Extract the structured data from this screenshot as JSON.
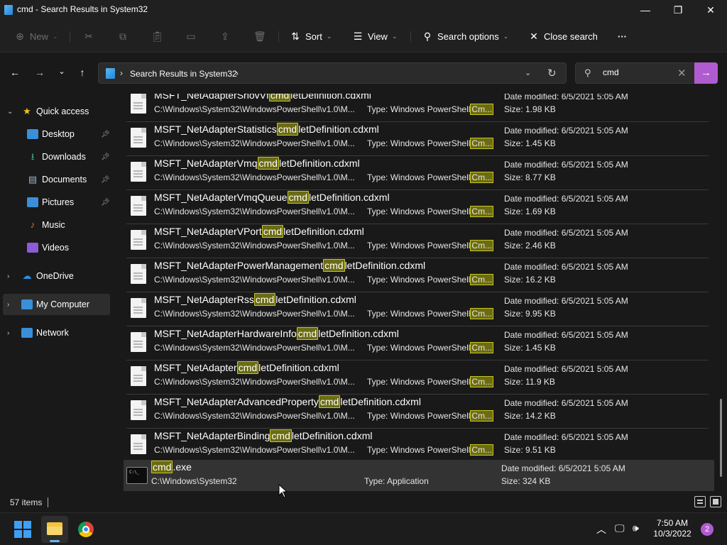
{
  "window": {
    "title": "cmd - Search Results in System32",
    "minimize_icon": "—",
    "maximize_icon": "❐",
    "close_icon": "✕"
  },
  "toolbar": {
    "new_label": "New",
    "sort_label": "Sort",
    "view_label": "View",
    "search_options_label": "Search options",
    "close_search_label": "Close search",
    "more_label": "···"
  },
  "address": {
    "crumb": "Search Results in System32"
  },
  "search": {
    "value": "cmd"
  },
  "sidebar": {
    "items": [
      {
        "label": "Quick access"
      },
      {
        "label": "Desktop"
      },
      {
        "label": "Downloads"
      },
      {
        "label": "Documents"
      },
      {
        "label": "Pictures"
      },
      {
        "label": "Music"
      },
      {
        "label": "Videos"
      },
      {
        "label": "OneDrive"
      },
      {
        "label": "My Computer"
      },
      {
        "label": "Network"
      }
    ]
  },
  "files": [
    {
      "pre": "MSFT_NetAdapterSriovVf",
      "hl": "cmd",
      "post": "letDefinition.cdxml",
      "path": "C:\\Windows\\System32\\WindowsPowerShell\\v1.0\\M...",
      "type_label": "Type:",
      "type": "Windows PowerShell",
      "type_hl": "Cm...",
      "date_label": "Date modified:",
      "date": "6/5/2021 5:05 AM",
      "size_label": "Size:",
      "size": "1.98 KB"
    },
    {
      "pre": "MSFT_NetAdapterStatistics",
      "hl": "cmd",
      "post": "letDefinition.cdxml",
      "path": "C:\\Windows\\System32\\WindowsPowerShell\\v1.0\\M...",
      "type_label": "Type:",
      "type": "Windows PowerShell",
      "type_hl": "Cm...",
      "date_label": "Date modified:",
      "date": "6/5/2021 5:05 AM",
      "size_label": "Size:",
      "size": "1.45 KB"
    },
    {
      "pre": "MSFT_NetAdapterVmq",
      "hl": "cmd",
      "post": "letDefinition.cdxml",
      "path": "C:\\Windows\\System32\\WindowsPowerShell\\v1.0\\M...",
      "type_label": "Type:",
      "type": "Windows PowerShell",
      "type_hl": "Cm...",
      "date_label": "Date modified:",
      "date": "6/5/2021 5:05 AM",
      "size_label": "Size:",
      "size": "8.77 KB"
    },
    {
      "pre": "MSFT_NetAdapterVmqQueue",
      "hl": "cmd",
      "post": "letDefinition.cdxml",
      "path": "C:\\Windows\\System32\\WindowsPowerShell\\v1.0\\M...",
      "type_label": "Type:",
      "type": "Windows PowerShell",
      "type_hl": "Cm...",
      "date_label": "Date modified:",
      "date": "6/5/2021 5:05 AM",
      "size_label": "Size:",
      "size": "1.69 KB"
    },
    {
      "pre": "MSFT_NetAdapterVPort",
      "hl": "cmd",
      "post": "letDefinition.cdxml",
      "path": "C:\\Windows\\System32\\WindowsPowerShell\\v1.0\\M...",
      "type_label": "Type:",
      "type": "Windows PowerShell",
      "type_hl": "Cm...",
      "date_label": "Date modified:",
      "date": "6/5/2021 5:05 AM",
      "size_label": "Size:",
      "size": "2.46 KB"
    },
    {
      "pre": "MSFT_NetAdapterPowerManagement",
      "hl": "cmd",
      "post": "letDefinition.cdxml",
      "path": "C:\\Windows\\System32\\WindowsPowerShell\\v1.0\\M...",
      "type_label": "Type:",
      "type": "Windows PowerShell",
      "type_hl": "Cm...",
      "date_label": "Date modified:",
      "date": "6/5/2021 5:05 AM",
      "size_label": "Size:",
      "size": "16.2 KB"
    },
    {
      "pre": "MSFT_NetAdapterRss",
      "hl": "cmd",
      "post": "letDefinition.cdxml",
      "path": "C:\\Windows\\System32\\WindowsPowerShell\\v1.0\\M...",
      "type_label": "Type:",
      "type": "Windows PowerShell",
      "type_hl": "Cm...",
      "date_label": "Date modified:",
      "date": "6/5/2021 5:05 AM",
      "size_label": "Size:",
      "size": "9.95 KB"
    },
    {
      "pre": "MSFT_NetAdapterHardwareInfo",
      "hl": "cmd",
      "post": "letDefinition.cdxml",
      "path": "C:\\Windows\\System32\\WindowsPowerShell\\v1.0\\M...",
      "type_label": "Type:",
      "type": "Windows PowerShell",
      "type_hl": "Cm...",
      "date_label": "Date modified:",
      "date": "6/5/2021 5:05 AM",
      "size_label": "Size:",
      "size": "1.45 KB"
    },
    {
      "pre": "MSFT_NetAdapter",
      "hl": "cmd",
      "post": "letDefinition.cdxml",
      "path": "C:\\Windows\\System32\\WindowsPowerShell\\v1.0\\M...",
      "type_label": "Type:",
      "type": "Windows PowerShell",
      "type_hl": "Cm...",
      "date_label": "Date modified:",
      "date": "6/5/2021 5:05 AM",
      "size_label": "Size:",
      "size": "11.9 KB"
    },
    {
      "pre": "MSFT_NetAdapterAdvancedProperty",
      "hl": "cmd",
      "post": "letDefinition.cdxml",
      "path": "C:\\Windows\\System32\\WindowsPowerShell\\v1.0\\M...",
      "type_label": "Type:",
      "type": "Windows PowerShell",
      "type_hl": "Cm...",
      "date_label": "Date modified:",
      "date": "6/5/2021 5:05 AM",
      "size_label": "Size:",
      "size": "14.2 KB"
    },
    {
      "pre": "MSFT_NetAdapterBinding",
      "hl": "cmd",
      "post": "letDefinition.cdxml",
      "path": "C:\\Windows\\System32\\WindowsPowerShell\\v1.0\\M...",
      "type_label": "Type:",
      "type": "Windows PowerShell",
      "type_hl": "Cm...",
      "date_label": "Date modified:",
      "date": "6/5/2021 5:05 AM",
      "size_label": "Size:",
      "size": "9.51 KB"
    },
    {
      "pre": "",
      "hl": "cmd",
      "post": ".exe",
      "path": "C:\\Windows\\System32",
      "type_label": "Type:",
      "type": "Application",
      "type_hl": "",
      "date_label": "Date modified:",
      "date": "6/5/2021 5:05 AM",
      "size_label": "Size:",
      "size": "324 KB"
    }
  ],
  "status": {
    "count": "57 items"
  },
  "taskbar": {
    "time": "7:50 AM",
    "date": "10/3/2022",
    "notifications": "2"
  },
  "colors": {
    "accent": "#b15bd0",
    "highlight_bg": "#6b6b12",
    "highlight_border": "#c8c820",
    "background": "#191919"
  }
}
